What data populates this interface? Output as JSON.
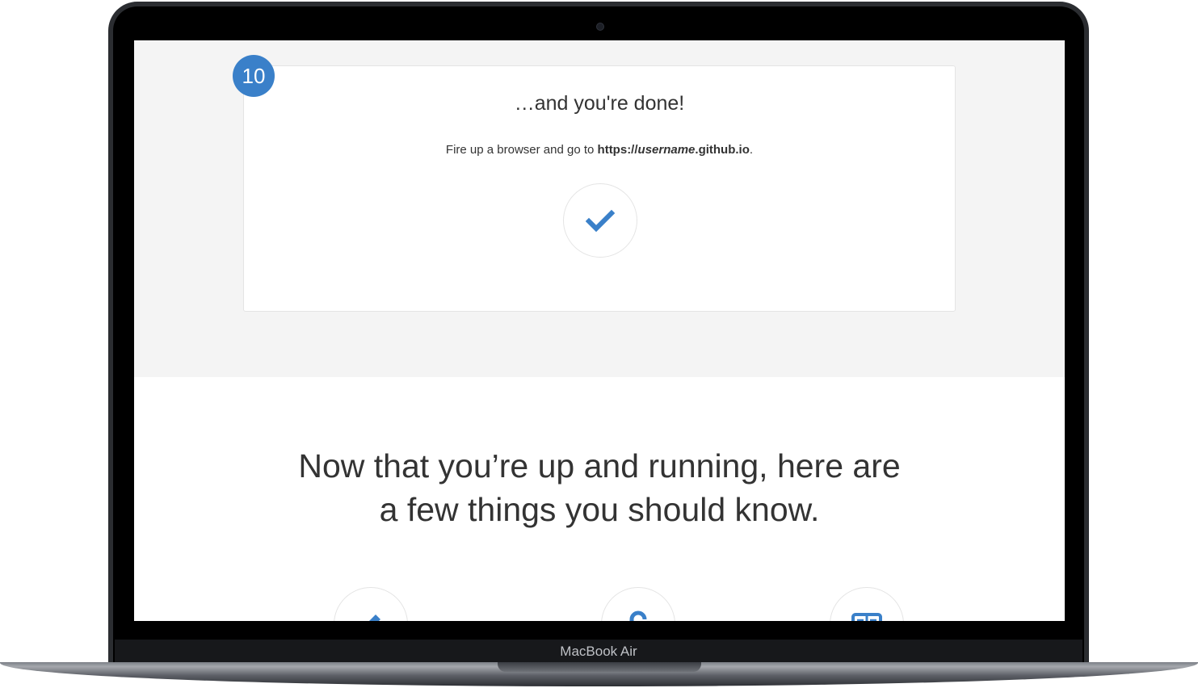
{
  "device": {
    "brand_label": "MacBook Air"
  },
  "step": {
    "number": "10",
    "title": "…and you're done!",
    "text_prefix": "Fire up a browser and go to ",
    "url_scheme": "https://",
    "url_user": "username",
    "url_domain": ".github.io",
    "text_suffix": ".",
    "status_icon": "checkmark-icon"
  },
  "next_section": {
    "headline_line1": "Now that you’re up and running, here are",
    "headline_line2": "a few things you should know."
  },
  "feature_icons": [
    "pencil-icon",
    "lock-icon",
    "book-icon"
  ],
  "colors": {
    "accent": "#3a80c9",
    "band_background": "#f4f4f4",
    "text": "#333333"
  }
}
